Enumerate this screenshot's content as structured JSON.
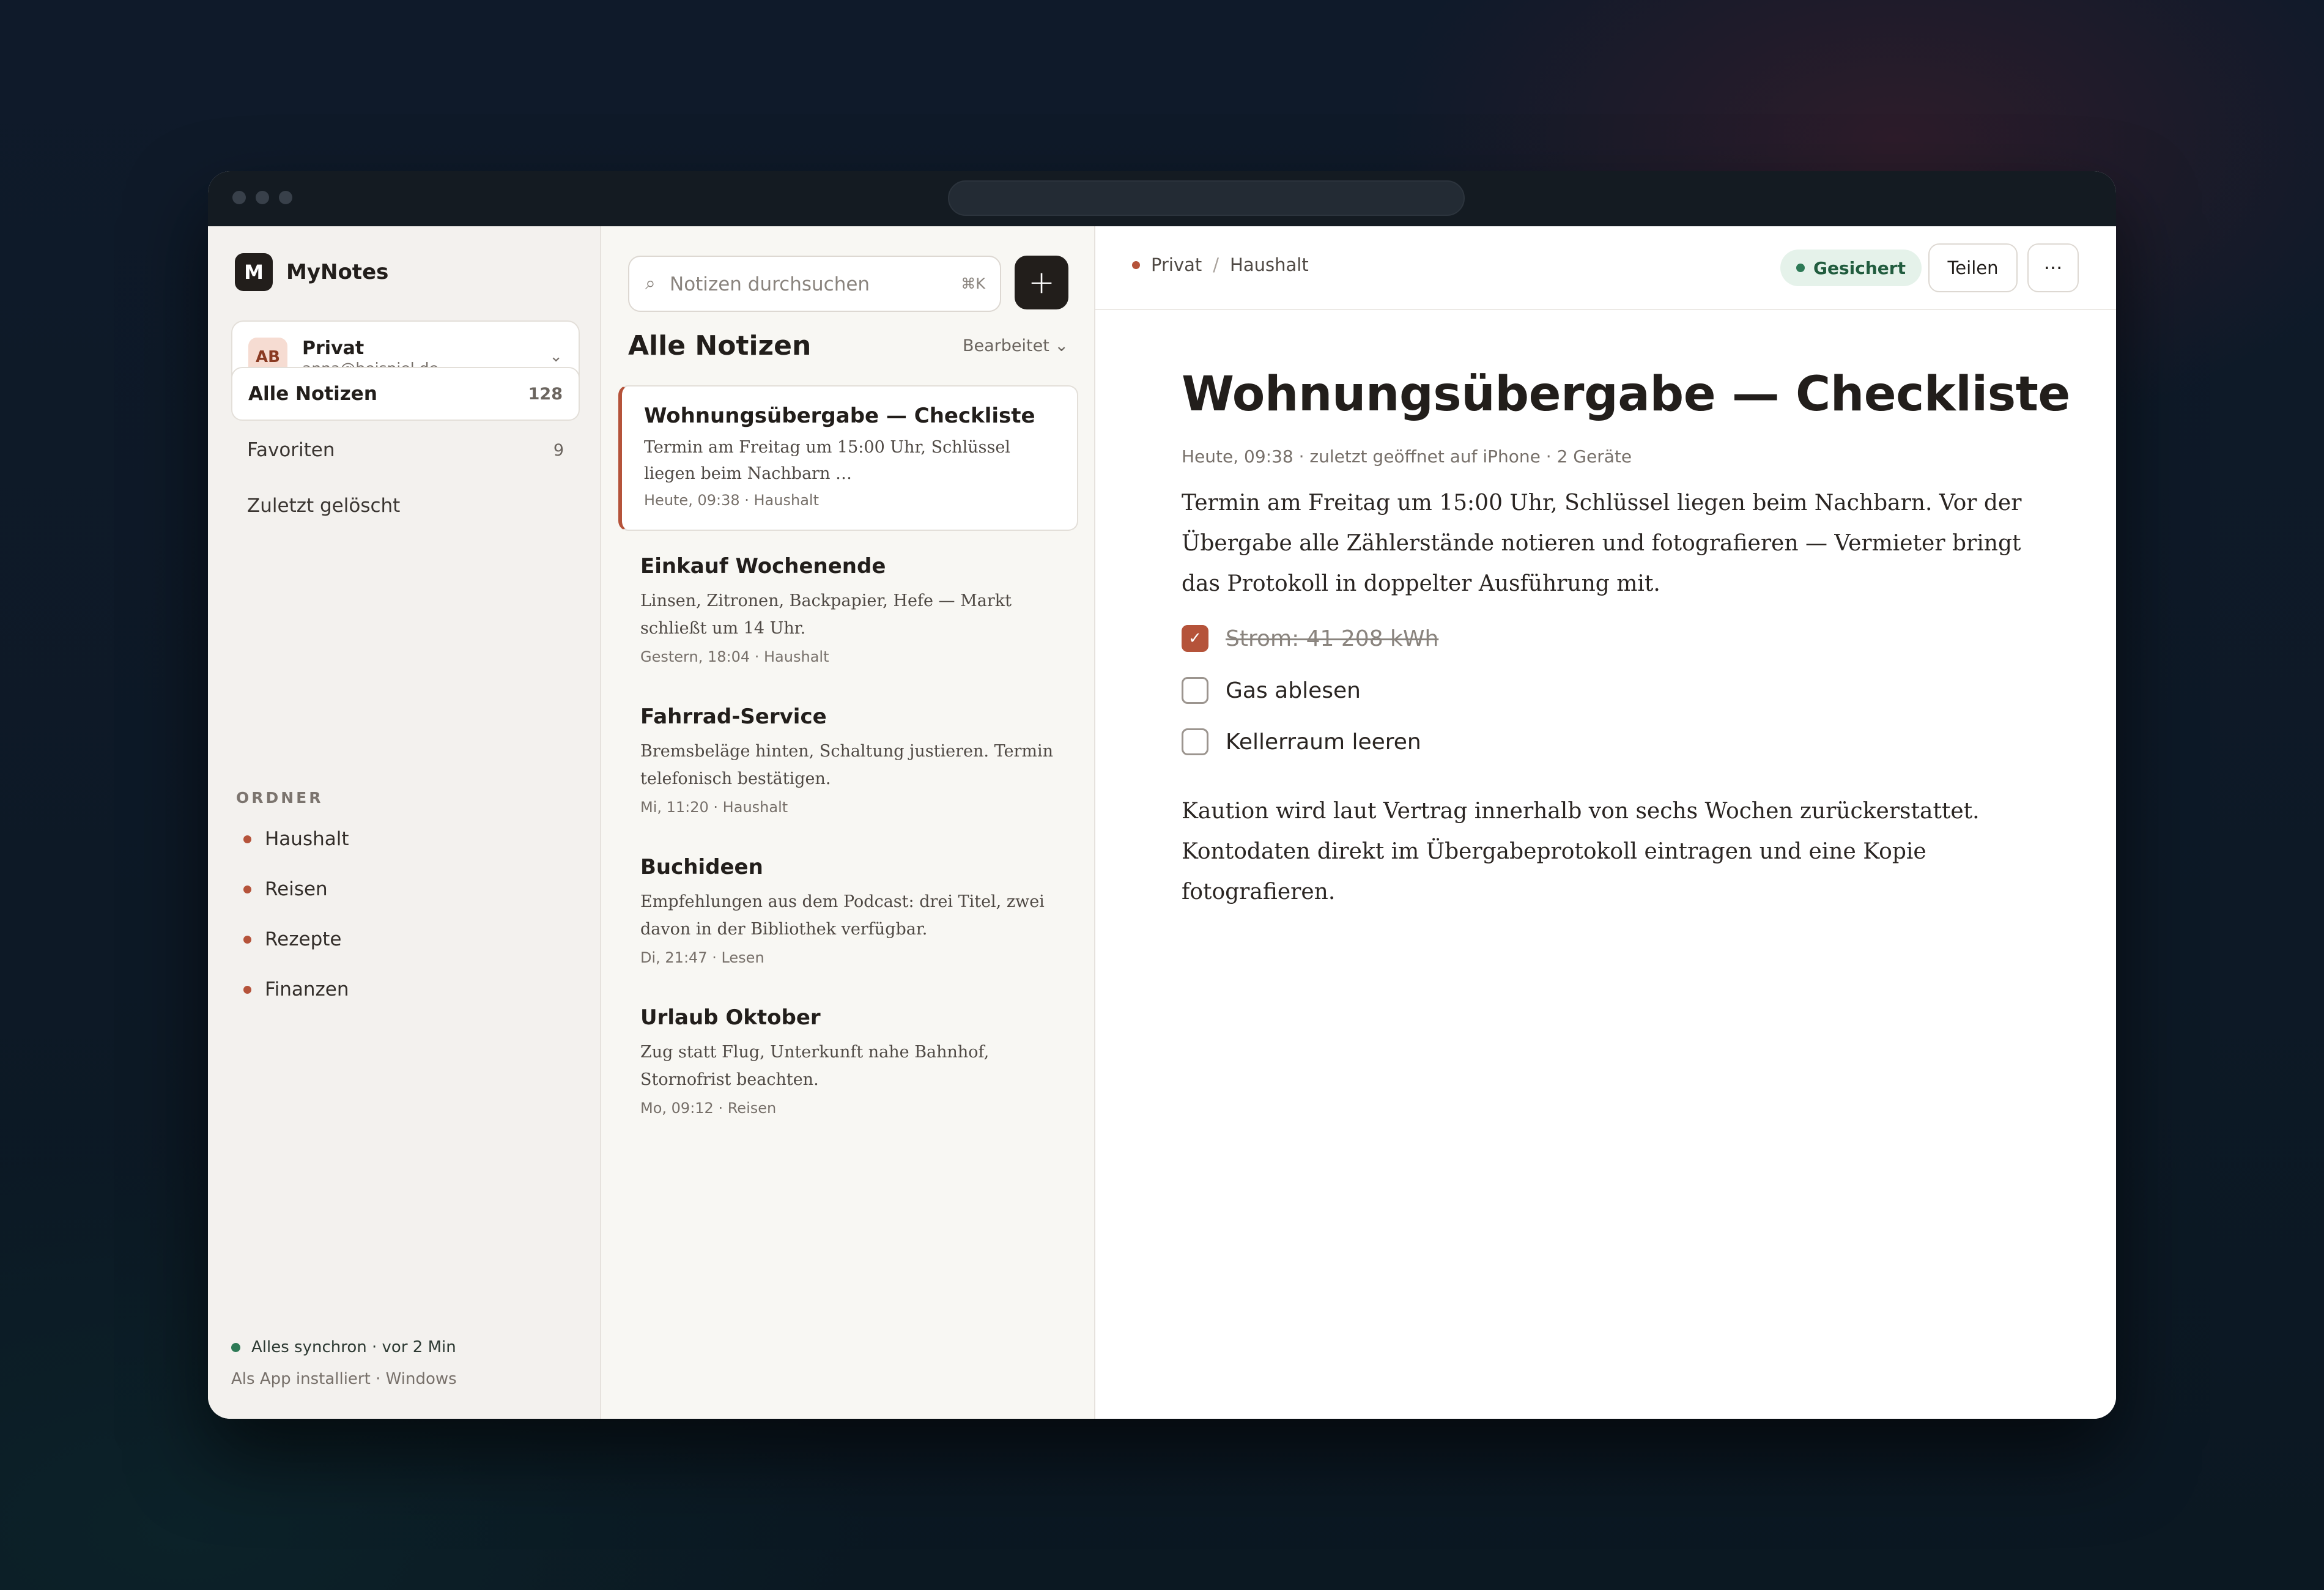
{
  "app": {
    "logo_letter": "M",
    "name": "MyNotes"
  },
  "account": {
    "initials": "AB",
    "name": "Privat",
    "email": "anna@beispiel.de",
    "chevron": "⌄"
  },
  "nav": [
    {
      "label": "Alle Notizen",
      "count": "128",
      "active": true
    },
    {
      "label": "Favoriten",
      "count": "9",
      "active": false
    },
    {
      "label": "Zuletzt gelöscht",
      "count": "",
      "active": false
    }
  ],
  "folders": {
    "label": "ORDNER",
    "items": [
      "Haushalt",
      "Reisen",
      "Rezepte",
      "Finanzen"
    ]
  },
  "status": {
    "sync": "Alles synchron · vor 2 Min",
    "installed": "Als App installiert · Windows"
  },
  "list": {
    "search_placeholder": "Notizen durchsuchen",
    "search_shortcut": "⌘K",
    "add_label": "+",
    "title": "Alle Notizen",
    "sort_label": "Bearbeitet ⌄",
    "notes": [
      {
        "title": "Wohnungsübergabe — Checkliste",
        "snippet": "Termin am Freitag um 15:00 Uhr, Schlüssel liegen beim Nachbarn …",
        "meta": "Heute, 09:38 · Haushalt"
      },
      {
        "title": "Einkauf Wochenende",
        "snippet": "Linsen, Zitronen, Backpapier, Hefe — Markt schließt um 14 Uhr.",
        "meta": "Gestern, 18:04 · Haushalt"
      },
      {
        "title": "Fahrrad-Service",
        "snippet": "Bremsbeläge hinten, Schaltung justieren. Termin telefonisch bestätigen.",
        "meta": "Mi, 11:20 · Haushalt"
      },
      {
        "title": "Buchideen",
        "snippet": "Empfehlungen aus dem Podcast: drei Titel, zwei davon in der Bibliothek verfügbar.",
        "meta": "Di, 21:47 · Lesen"
      },
      {
        "title": "Urlaub Oktober",
        "snippet": "Zug statt Flug, Unterkunft nahe Bahnhof, Stornofrist beachten.",
        "meta": "Mo, 09:12 · Reisen"
      }
    ]
  },
  "editor": {
    "breadcrumb": [
      "Privat",
      "Haushalt"
    ],
    "breadcrumb_sep": "/",
    "saved_label": "Gesichert",
    "share_label": "Teilen",
    "more_label": "···",
    "title": "Wohnungsübergabe — Checkliste",
    "meta": "Heute, 09:38 · zuletzt geöffnet auf iPhone · 2 Geräte",
    "paragraph1": "Termin am Freitag um 15:00 Uhr, Schlüssel liegen beim Nachbarn. Vor der Übergabe alle Zählerstände notieren und fotografieren — Vermieter bringt das Protokoll in doppelter Ausführung mit.",
    "checklist": [
      {
        "label": "Strom: 41 208 kWh",
        "checked": true
      },
      {
        "label": "Gas ablesen",
        "checked": false
      },
      {
        "label": "Kellerraum leeren",
        "checked": false
      }
    ],
    "checkmark": "✓",
    "paragraph2": "Kaution wird laut Vertrag innerhalb von sechs Wochen zurückerstattet. Kontodaten direkt im Übergabeprotokoll eintragen und eine Kopie fotografieren."
  },
  "colors": {
    "accent": "#b5533a",
    "sync_green": "#2d7a56",
    "dark": "#221e1b"
  }
}
